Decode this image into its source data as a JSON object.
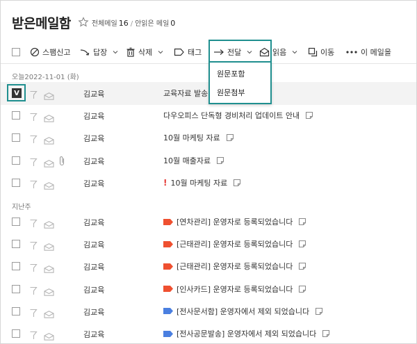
{
  "header": {
    "title": "받은메일함",
    "total_label": "전체메일",
    "total_count": "16",
    "separator": "/",
    "unread_label": "안읽은 메일",
    "unread_count": "0"
  },
  "toolbar": {
    "spam": "스팸신고",
    "reply": "답장",
    "delete": "삭제",
    "tag": "태그",
    "forward": "전달",
    "read": "읽음",
    "move": "이동",
    "more": "이 메일을"
  },
  "forward_menu": [
    "원문포함",
    "원문첨부"
  ],
  "sections": {
    "today": "오늘2022-11-01 (화)",
    "last_week": "지난주"
  },
  "selected_mark": "V",
  "rows_today": [
    {
      "sender": "김교육",
      "subject": "교육자료 발송"
    },
    {
      "sender": "김교육",
      "subject": "다우오피스 단독형 경비처리 업데이트 안내"
    },
    {
      "sender": "김교육",
      "subject": "10월 마케팅 자료"
    },
    {
      "sender": "김교육",
      "subject": "10월 매출자료"
    },
    {
      "sender": "김교육",
      "subject": "10월 마케팅 자료",
      "important": "!"
    }
  ],
  "rows_lastweek": [
    {
      "sender": "김교육",
      "subject": "[연차관리] 운영자로 등록되었습니다",
      "tag_color": "#ef5030"
    },
    {
      "sender": "김교육",
      "subject": "[근태관리] 운영자로 등록되었습니다",
      "tag_color": "#ef5030"
    },
    {
      "sender": "김교육",
      "subject": "[근태관리] 운영자로 등록되었습니다",
      "tag_color": "#ef5030"
    },
    {
      "sender": "김교육",
      "subject": "[인사카드] 운영자로 등록되었습니다",
      "tag_color": "#ef5030"
    },
    {
      "sender": "김교육",
      "subject": "[전사문서함] 운영자에서 제외 되었습니다",
      "tag_color": "#4a7fe0"
    },
    {
      "sender": "김교육",
      "subject": "[전사공문발송] 운영자에서 제외 되었습니다",
      "tag_color": "#4a7fe0"
    }
  ]
}
